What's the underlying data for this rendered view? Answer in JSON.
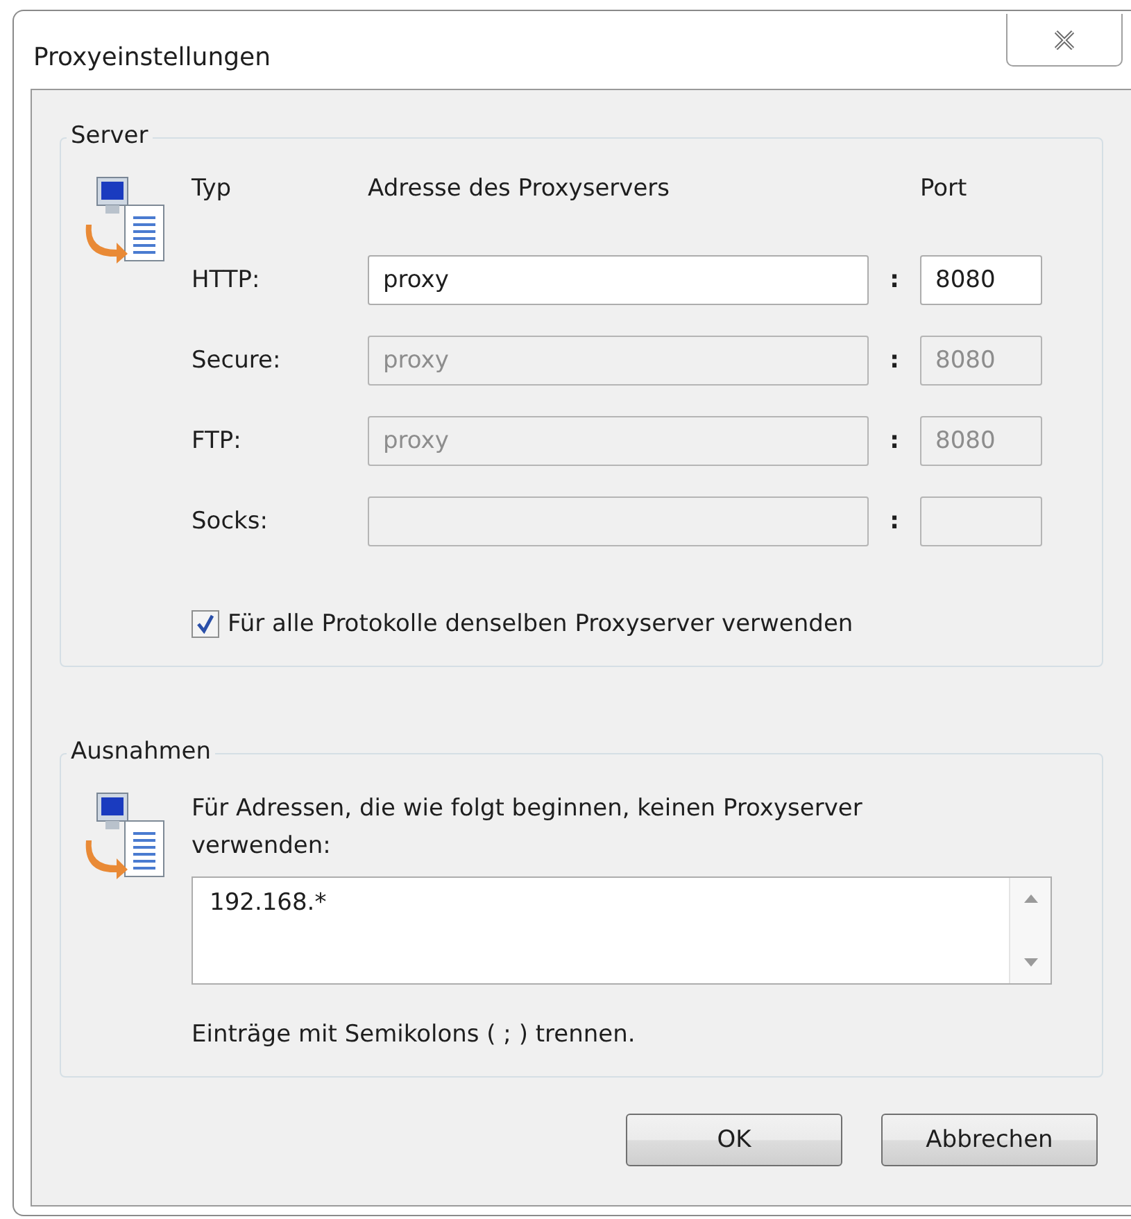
{
  "window": {
    "title": "Proxyeinstellungen"
  },
  "server": {
    "title": "Server",
    "headers": [
      "Typ",
      "Adresse des Proxyservers",
      "Port"
    ],
    "rows": [
      {
        "type": "HTTP:",
        "address": "proxy",
        "separator": ":",
        "port": "8080",
        "disabled": false
      },
      {
        "type": "Secure:",
        "address": "proxy",
        "separator": ":",
        "port": "8080",
        "disabled": true
      },
      {
        "type": "FTP:",
        "address": "proxy",
        "separator": ":",
        "port": "8080",
        "disabled": true
      },
      {
        "type": "Socks:",
        "separator": ":",
        "disabled": true
      }
    ],
    "same_proxy": {
      "label": "Für alle Protokolle denselben Proxyserver verwenden",
      "checked": true
    }
  },
  "exceptions": {
    "title": "Ausnahmen",
    "description": "Für Adressen, die wie folgt beginnen, keinen Proxyserver verwenden:",
    "value": "192.168.*",
    "hint": "Einträge mit Semikolons ( ; ) trennen."
  },
  "buttons": [
    "OK",
    "Abbrechen"
  ]
}
